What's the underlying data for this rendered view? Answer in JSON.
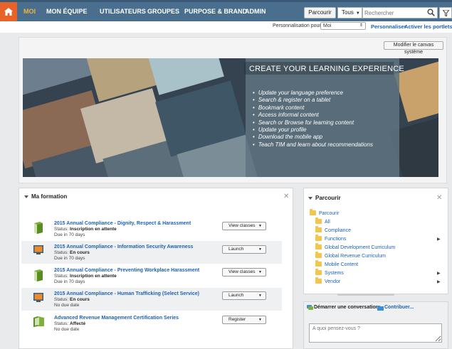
{
  "nav": {
    "items": [
      "MOI",
      "MON ÉQUIPE",
      "UTILISATEURS",
      "GROUPES",
      "PURPOSE & BRAND",
      "ADMIN"
    ],
    "active_index": 0,
    "browse_button": "Parcourir",
    "search_scope": "Tous",
    "search_placeholder": "Rechercher",
    "bar_color": "#4a6f8e",
    "home_color": "#e8632a",
    "active_color": "#f3b23a"
  },
  "personalization": {
    "label": "Personnalisation pour :",
    "selected": "Moi",
    "customize_link": "Personnaliser",
    "activate_link": "Activer les portlets"
  },
  "canvas": {
    "edit_button": "Modifier le canvas système",
    "banner_title": "CREATE YOUR LEARNING EXPERIENCE",
    "banner_items": [
      "Update your language preference",
      "Search & register on a tablet",
      "Bookmark content",
      "Access informal content",
      "Search or Browse for learning content",
      "Update your profile",
      "Download the mobile app",
      "Teach TIM and learn about recommendations"
    ]
  },
  "formation": {
    "title": "Ma formation",
    "courses": [
      {
        "title": "2015 Annual Compliance - Dignity, Respect & Harassment",
        "status_label": "Status:",
        "status": "Inscription en attente",
        "due": "Due in 70 days",
        "action": "View classes",
        "icon": "book-icon"
      },
      {
        "title": "2015 Annual Compliance - Information Security Awareness",
        "status_label": "Status:",
        "status": "En cours",
        "due": "Due in 70 days",
        "action": "Launch",
        "icon": "online-course-icon"
      },
      {
        "title": "2015 Annual Compliance - Preventing Workplace Harassment",
        "status_label": "Status:",
        "status": "Inscription en attente",
        "due": "Due in 70 days",
        "action": "View classes",
        "icon": "book-icon"
      },
      {
        "title": "2015 Annual Compliance - Human Trafficking (Select Service)",
        "status_label": "Status:",
        "status": "En cours",
        "due": "No due date",
        "action": "Launch",
        "icon": "online-course-icon"
      },
      {
        "title": "Advanced Revenue Management Certification Series",
        "status_label": "Status:",
        "status": "Affecté",
        "due": "No due date",
        "action": "Register",
        "icon": "curriculum-icon"
      }
    ]
  },
  "browse": {
    "title": "Parcourir",
    "root": "Parcourir",
    "items": [
      {
        "label": "All",
        "expandable": false
      },
      {
        "label": "Compliance",
        "expandable": false
      },
      {
        "label": "Functions",
        "expandable": true
      },
      {
        "label": "Global Development Curriculum",
        "expandable": false
      },
      {
        "label": "Global Revenue Curriculum",
        "expandable": false
      },
      {
        "label": "Mobile Content",
        "expandable": false
      },
      {
        "label": "Systems",
        "expandable": true
      },
      {
        "label": "Vendor",
        "expandable": true
      }
    ]
  },
  "social": {
    "tab_conversation": "Démarrer une conversation",
    "tab_contribute": "Contribuer...",
    "placeholder": "A quoi pensez-vous ?"
  }
}
